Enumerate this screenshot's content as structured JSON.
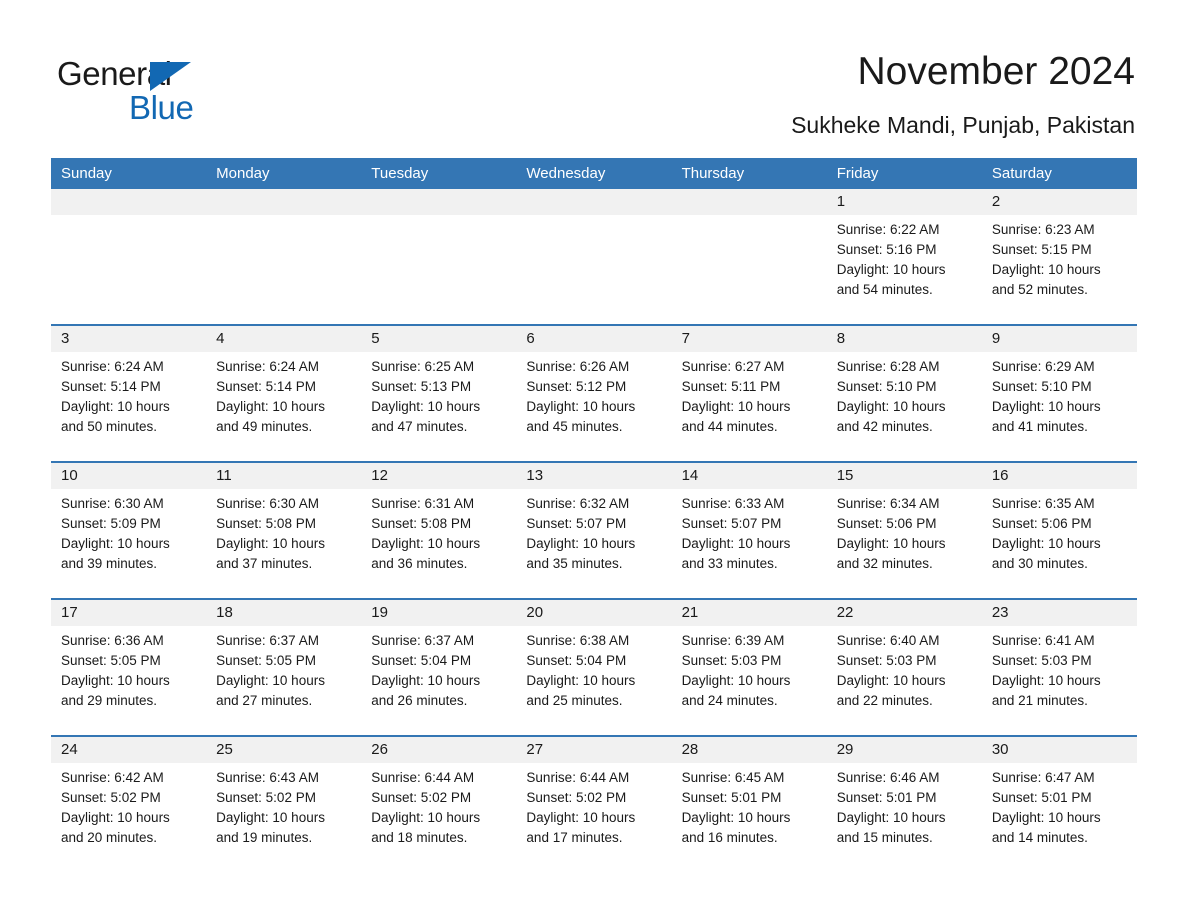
{
  "brand": {
    "name_part1": "General",
    "name_part2": "Blue",
    "accent_color": "#1268b3"
  },
  "header": {
    "title": "November 2024",
    "subtitle": "Sukheke Mandi, Punjab, Pakistan"
  },
  "theme": {
    "header_row_bg": "#3476b4",
    "daynum_strip_bg": "#f1f1f1",
    "week_divider": "#3476b4",
    "page_bg": "#ffffff",
    "text": "#1a1a1a"
  },
  "weekdays": [
    "Sunday",
    "Monday",
    "Tuesday",
    "Wednesday",
    "Thursday",
    "Friday",
    "Saturday"
  ],
  "weeks": [
    [
      {
        "day": "",
        "lines": []
      },
      {
        "day": "",
        "lines": []
      },
      {
        "day": "",
        "lines": []
      },
      {
        "day": "",
        "lines": []
      },
      {
        "day": "",
        "lines": []
      },
      {
        "day": "1",
        "lines": [
          "Sunrise: 6:22 AM",
          "Sunset: 5:16 PM",
          "Daylight: 10 hours",
          "and 54 minutes."
        ]
      },
      {
        "day": "2",
        "lines": [
          "Sunrise: 6:23 AM",
          "Sunset: 5:15 PM",
          "Daylight: 10 hours",
          "and 52 minutes."
        ]
      }
    ],
    [
      {
        "day": "3",
        "lines": [
          "Sunrise: 6:24 AM",
          "Sunset: 5:14 PM",
          "Daylight: 10 hours",
          "and 50 minutes."
        ]
      },
      {
        "day": "4",
        "lines": [
          "Sunrise: 6:24 AM",
          "Sunset: 5:14 PM",
          "Daylight: 10 hours",
          "and 49 minutes."
        ]
      },
      {
        "day": "5",
        "lines": [
          "Sunrise: 6:25 AM",
          "Sunset: 5:13 PM",
          "Daylight: 10 hours",
          "and 47 minutes."
        ]
      },
      {
        "day": "6",
        "lines": [
          "Sunrise: 6:26 AM",
          "Sunset: 5:12 PM",
          "Daylight: 10 hours",
          "and 45 minutes."
        ]
      },
      {
        "day": "7",
        "lines": [
          "Sunrise: 6:27 AM",
          "Sunset: 5:11 PM",
          "Daylight: 10 hours",
          "and 44 minutes."
        ]
      },
      {
        "day": "8",
        "lines": [
          "Sunrise: 6:28 AM",
          "Sunset: 5:10 PM",
          "Daylight: 10 hours",
          "and 42 minutes."
        ]
      },
      {
        "day": "9",
        "lines": [
          "Sunrise: 6:29 AM",
          "Sunset: 5:10 PM",
          "Daylight: 10 hours",
          "and 41 minutes."
        ]
      }
    ],
    [
      {
        "day": "10",
        "lines": [
          "Sunrise: 6:30 AM",
          "Sunset: 5:09 PM",
          "Daylight: 10 hours",
          "and 39 minutes."
        ]
      },
      {
        "day": "11",
        "lines": [
          "Sunrise: 6:30 AM",
          "Sunset: 5:08 PM",
          "Daylight: 10 hours",
          "and 37 minutes."
        ]
      },
      {
        "day": "12",
        "lines": [
          "Sunrise: 6:31 AM",
          "Sunset: 5:08 PM",
          "Daylight: 10 hours",
          "and 36 minutes."
        ]
      },
      {
        "day": "13",
        "lines": [
          "Sunrise: 6:32 AM",
          "Sunset: 5:07 PM",
          "Daylight: 10 hours",
          "and 35 minutes."
        ]
      },
      {
        "day": "14",
        "lines": [
          "Sunrise: 6:33 AM",
          "Sunset: 5:07 PM",
          "Daylight: 10 hours",
          "and 33 minutes."
        ]
      },
      {
        "day": "15",
        "lines": [
          "Sunrise: 6:34 AM",
          "Sunset: 5:06 PM",
          "Daylight: 10 hours",
          "and 32 minutes."
        ]
      },
      {
        "day": "16",
        "lines": [
          "Sunrise: 6:35 AM",
          "Sunset: 5:06 PM",
          "Daylight: 10 hours",
          "and 30 minutes."
        ]
      }
    ],
    [
      {
        "day": "17",
        "lines": [
          "Sunrise: 6:36 AM",
          "Sunset: 5:05 PM",
          "Daylight: 10 hours",
          "and 29 minutes."
        ]
      },
      {
        "day": "18",
        "lines": [
          "Sunrise: 6:37 AM",
          "Sunset: 5:05 PM",
          "Daylight: 10 hours",
          "and 27 minutes."
        ]
      },
      {
        "day": "19",
        "lines": [
          "Sunrise: 6:37 AM",
          "Sunset: 5:04 PM",
          "Daylight: 10 hours",
          "and 26 minutes."
        ]
      },
      {
        "day": "20",
        "lines": [
          "Sunrise: 6:38 AM",
          "Sunset: 5:04 PM",
          "Daylight: 10 hours",
          "and 25 minutes."
        ]
      },
      {
        "day": "21",
        "lines": [
          "Sunrise: 6:39 AM",
          "Sunset: 5:03 PM",
          "Daylight: 10 hours",
          "and 24 minutes."
        ]
      },
      {
        "day": "22",
        "lines": [
          "Sunrise: 6:40 AM",
          "Sunset: 5:03 PM",
          "Daylight: 10 hours",
          "and 22 minutes."
        ]
      },
      {
        "day": "23",
        "lines": [
          "Sunrise: 6:41 AM",
          "Sunset: 5:03 PM",
          "Daylight: 10 hours",
          "and 21 minutes."
        ]
      }
    ],
    [
      {
        "day": "24",
        "lines": [
          "Sunrise: 6:42 AM",
          "Sunset: 5:02 PM",
          "Daylight: 10 hours",
          "and 20 minutes."
        ]
      },
      {
        "day": "25",
        "lines": [
          "Sunrise: 6:43 AM",
          "Sunset: 5:02 PM",
          "Daylight: 10 hours",
          "and 19 minutes."
        ]
      },
      {
        "day": "26",
        "lines": [
          "Sunrise: 6:44 AM",
          "Sunset: 5:02 PM",
          "Daylight: 10 hours",
          "and 18 minutes."
        ]
      },
      {
        "day": "27",
        "lines": [
          "Sunrise: 6:44 AM",
          "Sunset: 5:02 PM",
          "Daylight: 10 hours",
          "and 17 minutes."
        ]
      },
      {
        "day": "28",
        "lines": [
          "Sunrise: 6:45 AM",
          "Sunset: 5:01 PM",
          "Daylight: 10 hours",
          "and 16 minutes."
        ]
      },
      {
        "day": "29",
        "lines": [
          "Sunrise: 6:46 AM",
          "Sunset: 5:01 PM",
          "Daylight: 10 hours",
          "and 15 minutes."
        ]
      },
      {
        "day": "30",
        "lines": [
          "Sunrise: 6:47 AM",
          "Sunset: 5:01 PM",
          "Daylight: 10 hours",
          "and 14 minutes."
        ]
      }
    ]
  ]
}
